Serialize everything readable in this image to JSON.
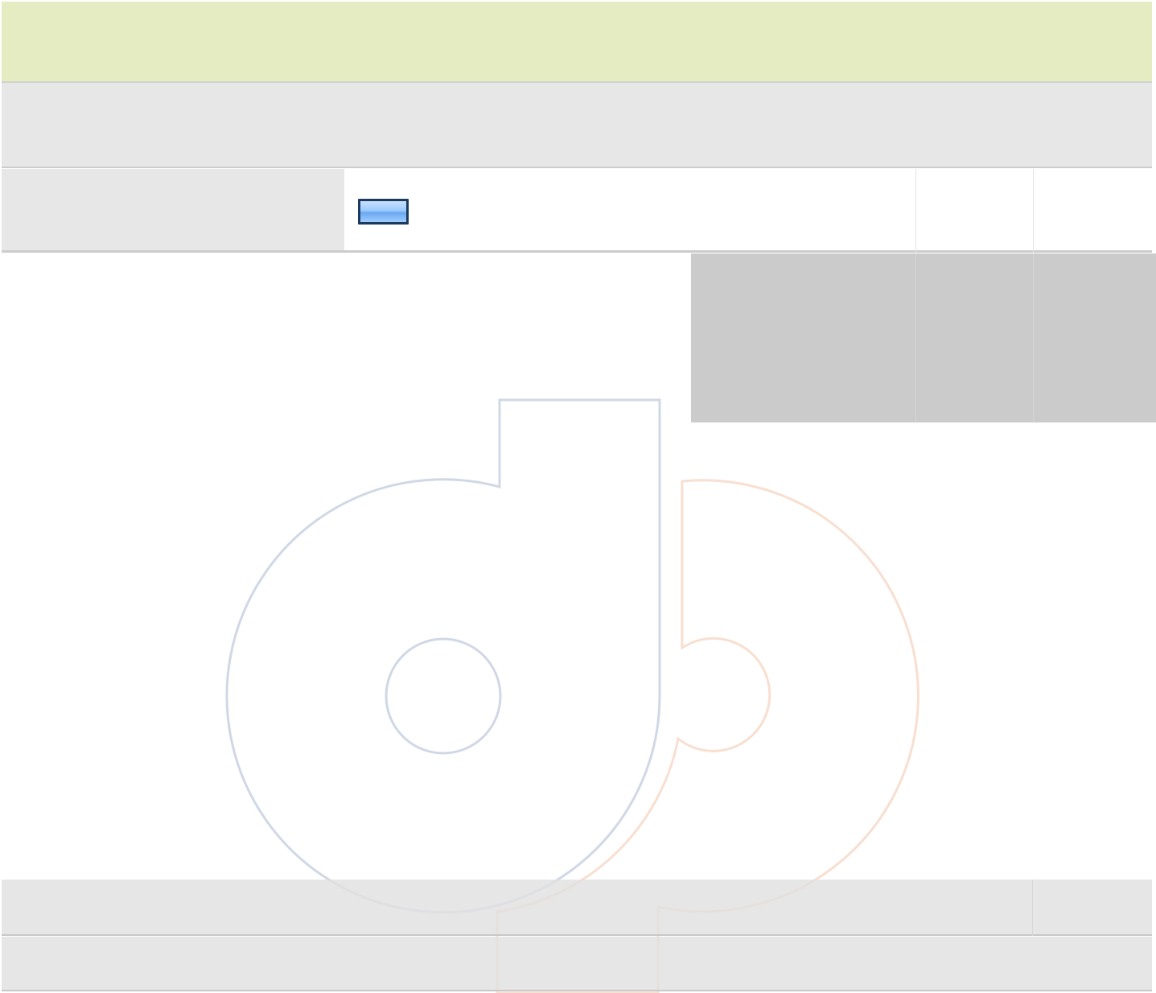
{
  "icons": {
    "watermark": "db-logo-watermark-icon"
  },
  "colors": {
    "header_band": "#e6ecc2",
    "row_background": "#e7e7e7",
    "overlay_panel": "#cbcbcb",
    "swatch_border": "#1b3a5e",
    "swatch_fill": "#9ccaff",
    "watermark_blue": "#d0d8e6",
    "watermark_orange": "#f8dfd0"
  }
}
